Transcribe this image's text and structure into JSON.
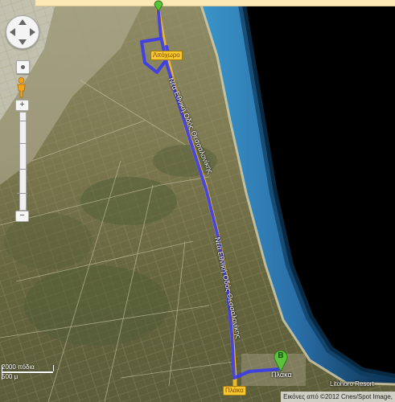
{
  "map": {
    "labels": {
      "top_town": "Λιτόχωρο",
      "bottom_town": "Πλάκα",
      "resort": "Litohoro Resort",
      "road_upper": "Νέα Εθνική Οδός Θεσσαλονίκης",
      "road_lower": "Νέα Εθνική Οδός Θεσσαλονίκης"
    },
    "marker_b": "B",
    "scale": {
      "large": "2000 πόδια",
      "small": "500 μ"
    },
    "copyright": "Εικόνες από ©2012 Cnes/Spot Image,",
    "colors": {
      "route": "#3a3aee",
      "sea": "#2a78b8",
      "deep_sea": "#000000",
      "marker": "#5cc23a"
    }
  }
}
